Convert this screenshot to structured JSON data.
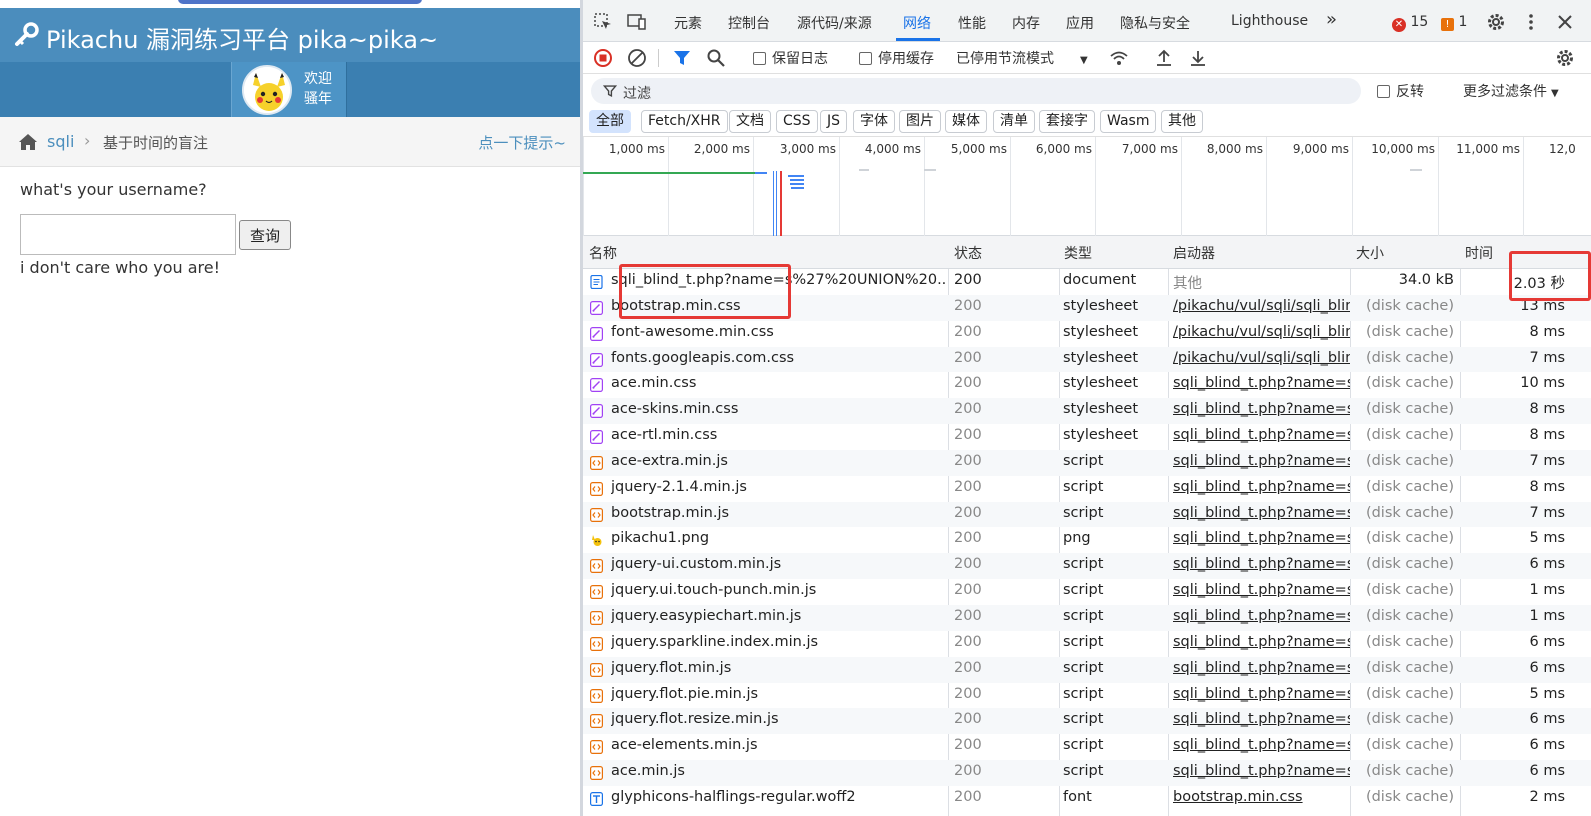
{
  "app": {
    "title": "Pikachu 漏洞练习平台 pika~pika~",
    "welcome_line1": "欢迎",
    "welcome_line2": "骚年",
    "breadcrumb_section": "sqli",
    "breadcrumb_separator": "›",
    "breadcrumb_current": "基于时间的盲注",
    "hint_link": "点一下提示~",
    "prompt": "what's your username?",
    "input_value": "",
    "query_button": "查询",
    "result": "i don't care who you are!"
  },
  "devtools": {
    "tabs": [
      "元素",
      "控制台",
      "源代码/来源",
      "网络",
      "性能",
      "内存",
      "应用",
      "隐私与安全",
      "Lighthouse"
    ],
    "active_tab": "网络",
    "more_tabs": "»",
    "errors_count": "15",
    "warnings_count": "1",
    "toolbar": {
      "preserve_log": "保留日志",
      "disable_cache": "停用缓存",
      "throttling": "已停用节流模式"
    },
    "filter": {
      "placeholder": "过滤",
      "invert": "反转",
      "more_filters": "更多过滤条件"
    },
    "type_filters": [
      "全部",
      "Fetch/XHR",
      "文档",
      "CSS",
      "JS",
      "字体",
      "图片",
      "媒体",
      "清单",
      "套接字",
      "Wasm",
      "其他"
    ],
    "timeline_ticks": [
      "1,000 ms",
      "2,000 ms",
      "3,000 ms",
      "4,000 ms",
      "5,000 ms",
      "6,000 ms",
      "7,000 ms",
      "8,000 ms",
      "9,000 ms",
      "10,000 ms",
      "11,000 ms",
      "12,0"
    ],
    "columns": {
      "name": "名称",
      "status": "状态",
      "type": "类型",
      "initiator": "启动器",
      "size": "大小",
      "time": "时间"
    },
    "rows": [
      {
        "name": "sqli_blind_t.php?name=s%27%20UNION%20...",
        "status": "200",
        "type": "document",
        "initiator": "其他",
        "size": "34.0 kB",
        "time": "2.03 秒",
        "icon": "document-icon"
      },
      {
        "name": "bootstrap.min.css",
        "status": "200",
        "type": "stylesheet",
        "initiator": "/pikachu/vul/sqli/sqli_blin",
        "size": "(disk cache)",
        "time": "13 ms",
        "icon": "stylesheet-icon"
      },
      {
        "name": "font-awesome.min.css",
        "status": "200",
        "type": "stylesheet",
        "initiator": "/pikachu/vul/sqli/sqli_blin",
        "size": "(disk cache)",
        "time": "8 ms",
        "icon": "stylesheet-icon"
      },
      {
        "name": "fonts.googleapis.com.css",
        "status": "200",
        "type": "stylesheet",
        "initiator": "/pikachu/vul/sqli/sqli_blin",
        "size": "(disk cache)",
        "time": "7 ms",
        "icon": "stylesheet-icon"
      },
      {
        "name": "ace.min.css",
        "status": "200",
        "type": "stylesheet",
        "initiator": "sqli_blind_t.php?name=s",
        "size": "(disk cache)",
        "time": "10 ms",
        "icon": "stylesheet-icon"
      },
      {
        "name": "ace-skins.min.css",
        "status": "200",
        "type": "stylesheet",
        "initiator": "sqli_blind_t.php?name=s",
        "size": "(disk cache)",
        "time": "8 ms",
        "icon": "stylesheet-icon"
      },
      {
        "name": "ace-rtl.min.css",
        "status": "200",
        "type": "stylesheet",
        "initiator": "sqli_blind_t.php?name=s",
        "size": "(disk cache)",
        "time": "8 ms",
        "icon": "stylesheet-icon"
      },
      {
        "name": "ace-extra.min.js",
        "status": "200",
        "type": "script",
        "initiator": "sqli_blind_t.php?name=s",
        "size": "(disk cache)",
        "time": "7 ms",
        "icon": "script-icon"
      },
      {
        "name": "jquery-2.1.4.min.js",
        "status": "200",
        "type": "script",
        "initiator": "sqli_blind_t.php?name=s",
        "size": "(disk cache)",
        "time": "8 ms",
        "icon": "script-icon"
      },
      {
        "name": "bootstrap.min.js",
        "status": "200",
        "type": "script",
        "initiator": "sqli_blind_t.php?name=s",
        "size": "(disk cache)",
        "time": "7 ms",
        "icon": "script-icon"
      },
      {
        "name": "pikachu1.png",
        "status": "200",
        "type": "png",
        "initiator": "sqli_blind_t.php?name=s",
        "size": "(disk cache)",
        "time": "5 ms",
        "icon": "image-icon"
      },
      {
        "name": "jquery-ui.custom.min.js",
        "status": "200",
        "type": "script",
        "initiator": "sqli_blind_t.php?name=s",
        "size": "(disk cache)",
        "time": "6 ms",
        "icon": "script-icon"
      },
      {
        "name": "jquery.ui.touch-punch.min.js",
        "status": "200",
        "type": "script",
        "initiator": "sqli_blind_t.php?name=s",
        "size": "(disk cache)",
        "time": "1 ms",
        "icon": "script-icon"
      },
      {
        "name": "jquery.easypiechart.min.js",
        "status": "200",
        "type": "script",
        "initiator": "sqli_blind_t.php?name=s",
        "size": "(disk cache)",
        "time": "1 ms",
        "icon": "script-icon"
      },
      {
        "name": "jquery.sparkline.index.min.js",
        "status": "200",
        "type": "script",
        "initiator": "sqli_blind_t.php?name=s",
        "size": "(disk cache)",
        "time": "6 ms",
        "icon": "script-icon"
      },
      {
        "name": "jquery.flot.min.js",
        "status": "200",
        "type": "script",
        "initiator": "sqli_blind_t.php?name=s",
        "size": "(disk cache)",
        "time": "6 ms",
        "icon": "script-icon"
      },
      {
        "name": "jquery.flot.pie.min.js",
        "status": "200",
        "type": "script",
        "initiator": "sqli_blind_t.php?name=s",
        "size": "(disk cache)",
        "time": "5 ms",
        "icon": "script-icon"
      },
      {
        "name": "jquery.flot.resize.min.js",
        "status": "200",
        "type": "script",
        "initiator": "sqli_blind_t.php?name=s",
        "size": "(disk cache)",
        "time": "6 ms",
        "icon": "script-icon"
      },
      {
        "name": "ace-elements.min.js",
        "status": "200",
        "type": "script",
        "initiator": "sqli_blind_t.php?name=s",
        "size": "(disk cache)",
        "time": "6 ms",
        "icon": "script-icon"
      },
      {
        "name": "ace.min.js",
        "status": "200",
        "type": "script",
        "initiator": "sqli_blind_t.php?name=s",
        "size": "(disk cache)",
        "time": "6 ms",
        "icon": "script-icon"
      },
      {
        "name": "glyphicons-halflings-regular.woff2",
        "status": "200",
        "type": "font",
        "initiator": "bootstrap.min.css",
        "size": "(disk cache)",
        "time": "2 ms",
        "icon": "font-icon"
      }
    ]
  },
  "colors": {
    "header_blue": "#4b8dbd",
    "userbar_blue": "#3b7fb1",
    "link_blue": "#4c8fbd",
    "devtools_accent": "#1a73e8",
    "highlight_red": "#e53935"
  }
}
